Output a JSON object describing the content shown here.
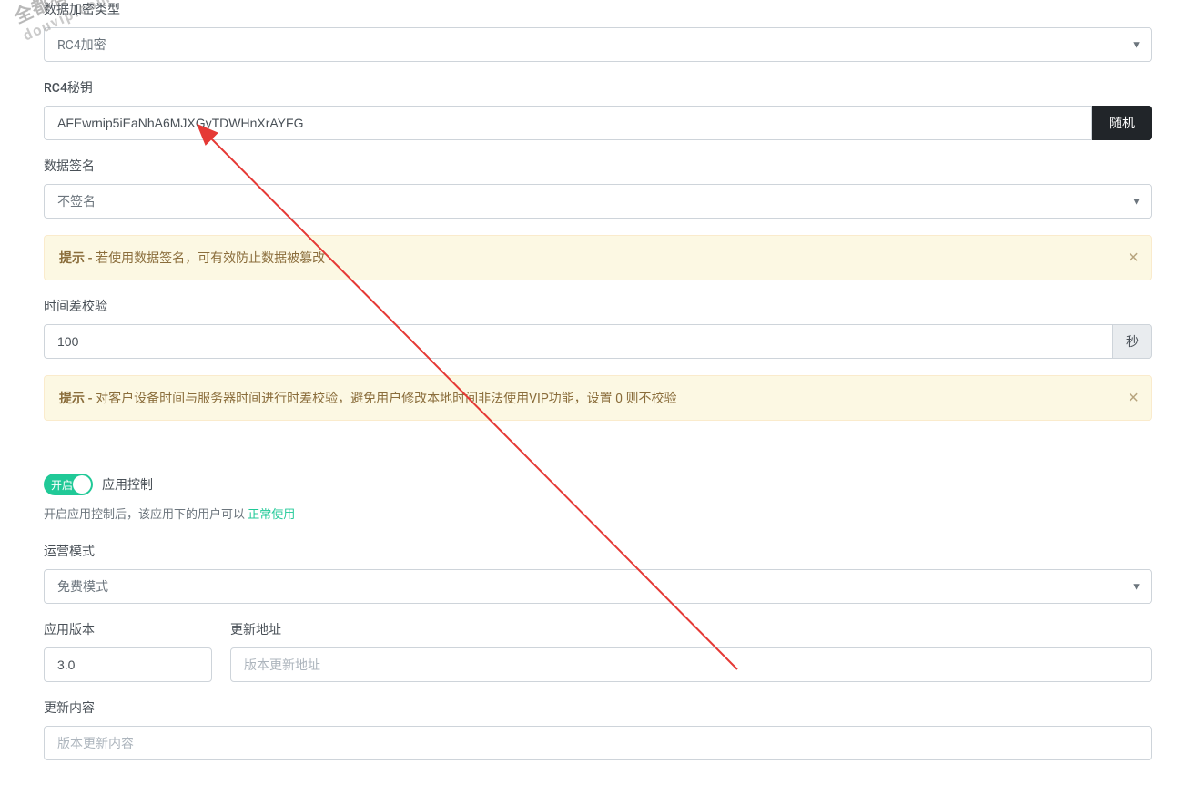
{
  "watermark": {
    "line1": "全都有综合资源网",
    "line2": "douvip.com"
  },
  "encryption": {
    "type_label": "数据加密类型",
    "type_value": "RC4加密",
    "key_label": "RC4秘钥",
    "key_value": "AFEwrnip5iEaNhA6MJXGyTDWHnXrAYFG",
    "random_btn": "随机"
  },
  "signature": {
    "label": "数据签名",
    "value": "不签名",
    "alert_prefix": "提示 - ",
    "alert_text": "若使用数据签名，可有效防止数据被篡改"
  },
  "time_check": {
    "label": "时间差校验",
    "value": "100",
    "unit": "秒",
    "alert_prefix": "提示 - ",
    "alert_text": "对客户设备时间与服务器时间进行时差校验，避免用户修改本地时间非法使用VIP功能，设置 0 则不校验"
  },
  "app_control": {
    "toggle_on": "开启",
    "title": "应用控制",
    "desc_prefix": "开启应用控制后，该应用下的用户可以 ",
    "desc_link": "正常使用"
  },
  "operation_mode": {
    "label": "运营模式",
    "value": "免费模式"
  },
  "version": {
    "app_version_label": "应用版本",
    "app_version_value": "3.0",
    "update_url_label": "更新地址",
    "update_url_placeholder": "版本更新地址",
    "update_content_label": "更新内容",
    "update_content_placeholder": "版本更新内容"
  }
}
